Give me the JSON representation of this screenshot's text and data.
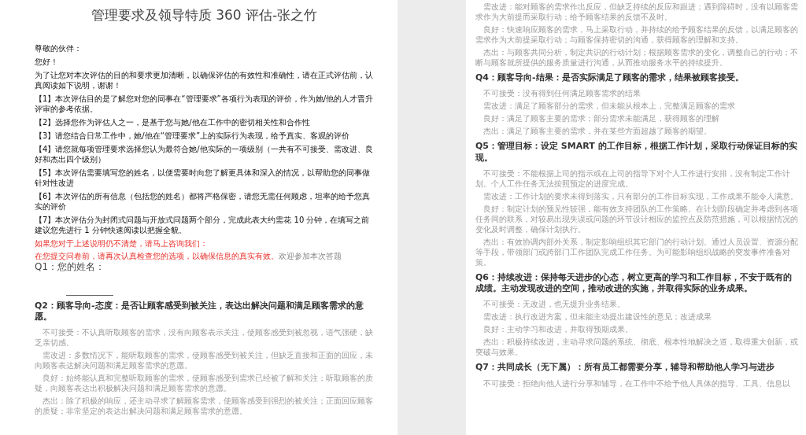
{
  "pages": [
    {
      "title": "管理要求及领导特质 360 评估-张之竹",
      "blocks": [
        {
          "kind": "text",
          "text": "尊敬的伙伴："
        },
        {
          "kind": "text",
          "text": "您好！"
        },
        {
          "kind": "text",
          "text": "为了让您对本次评估的目的和要求更加清晰，以确保评估的有效性和准确性，请在正式评估前，认真阅读如下说明，谢谢！"
        },
        {
          "kind": "text",
          "text": "【1】本次评估目的是了解您对您的同事在“管理要求”各项行为表现的评价，作为她/他的人才晋升评审的参考依据。"
        },
        {
          "kind": "text",
          "text": "【2】选择您作为评估人之一，是基于您与她/他在工作中的密切相关性和合作性"
        },
        {
          "kind": "text",
          "text": "【3】请您结合日常工作中，她/他在“管理要求”上的实际行为表现，给予真实、客观的评价"
        },
        {
          "kind": "text",
          "text": "【4】请您就每项管理要求选择您认为最符合她/他实际的一项级别（一共有不可接受、需改进、良好和杰出四个级别）"
        },
        {
          "kind": "text",
          "text": "【5】本次评估需要填写您的姓名，以便需要时向您了解更具体和深入的情况，以帮助您的同事做针对性改进"
        },
        {
          "kind": "text",
          "text": "【6】本次评估的所有信息（包括您的姓名）都将严格保密，请您无需任何顾虑，坦率的给予您真实的评价"
        },
        {
          "kind": "text",
          "text": "【7】本次评估分为封闭式问题与开放式问题两个部分，完成此表大约需花 10 分钟，在填写之前建议您先进行 1 分钟快速阅读以把握全貌。"
        },
        {
          "kind": "notice",
          "text": "如果您对于上述说明仍不清楚，请马上咨询我们："
        },
        {
          "kind": "notice",
          "text": "在您提交问卷前，请再次认真检查您的选项，以确保信息的真实有效。",
          "tail": "欢迎参加本次答题"
        },
        {
          "kind": "prompt",
          "text": "Q1：您的姓名："
        },
        {
          "kind": "blank"
        },
        {
          "kind": "question",
          "text": "Q2：顾客导向-态度：是否让顾客感受到被关注，表达出解决问题和满足顾客需求的意愿。"
        },
        {
          "kind": "level",
          "text": "不可接受：不认真听取顾客的需求，没有向顾客表示关注，使顾客感受到被忽视，语气强硬，缺乏亲切感。"
        },
        {
          "kind": "level",
          "text": "需改进：多数情况下，能听取顾客的需求，使顾客感受到被关注，但缺乏直接和正面的回应，未向顾客表达解决问题和满足顾客需求的意愿。"
        },
        {
          "kind": "level",
          "text": "良好：始终能认真和完整听取顾客的需求，使顾客感受到需求已经被了解和关注；听取顾客的质疑，向顾客表达出积极解决问题和满足顾客需求的意愿。"
        },
        {
          "kind": "level",
          "text": "杰出：除了积极的响应，还主动寻求了解顾客需求，使顾客感受到强烈的被关注；正面回应顾客的质疑；非常坚定的表达出解决问题和满足顾客需求的意愿。"
        }
      ]
    },
    {
      "blocks": [
        {
          "kind": "level",
          "text": "需改进：能对顾客的需求作出反应，但缺乏持续的反应和跟进；遇到障碍时，没有以顾客需求作为大前提而采取行动；给予顾客结果的反馈不及时。"
        },
        {
          "kind": "level",
          "text": "良好：快速响应顾客的需求，马上采取行动，并持续的给予顾客结果的反馈，以满足顾客的需求作为大前提采取行动；与顾客保持密切的沟通，获得顾客的理解和支持。"
        },
        {
          "kind": "level",
          "text": "杰出：与顾客共同分析，制定共识的行动计划；根据顾客需求的变化，调整自己的行动；不断与顾客就所提供的服务质量进行沟通，从而推动服务水平的持续提升。"
        },
        {
          "kind": "question",
          "text": "Q4：顾客导向-结果：是否实际满足了顾客的需求，结果被顾客接受。"
        },
        {
          "kind": "level",
          "text": "不可接受：没有得到任何满足顾客需求的结果"
        },
        {
          "kind": "level",
          "text": "需改进：满足了顾客部分的需求，但未能从根本上，完整满足顾客的需求"
        },
        {
          "kind": "level",
          "text": "良好：满足了顾客主要的需求；部分需求未能满足，获得顾客的理解"
        },
        {
          "kind": "level",
          "text": "杰出：满足了顾客主要的需求，并在某些方面超越了顾客的期望。"
        },
        {
          "kind": "question",
          "text": "Q5：管理目标：设定 SMART 的工作目标，根据工作计划，采取行动保证目标的实现。"
        },
        {
          "kind": "level",
          "text": "不可接受：不能根据上司的指示或在上司的指导下对个人工作进行安排，没有制定工作计划。个人工作任务无法按照预定的进度完成。"
        },
        {
          "kind": "level",
          "text": "需改进：工作计划的要求未得到落实，只有部分的工作目标实现，工作成果不能令人满意。"
        },
        {
          "kind": "level",
          "text": "良好：制定计划的预见性较强，能有效支持团队的工作策略。在计划阶段确定并考虑到各项任务间的联系，对较易出现失误或问题的环节设计相应的监控点及防范措施，可以根据情况的变化及时调整，确保计划执行。"
        },
        {
          "kind": "level",
          "text": "杰出：有效协调内部外关系，制定影响组织其它部门的行动计划。通过人员设置、资源分配等手段，带领部门或跨部门工作团队完成工作任务。为可能影响组织战略的突发事件准备对策。"
        },
        {
          "kind": "question",
          "text": "Q6：持续改进：保持每天进步的心态，树立更高的学习和工作目标，不安于既有的成绩。主动发现改进的空间，推动改进的实施，并取得实际的业务成果。"
        },
        {
          "kind": "level",
          "text": "不可接受：无改进，也无提升业务结果。"
        },
        {
          "kind": "level",
          "text": "需改进：执行改进方案，但未能主动提出建设性的意见；改进成果"
        },
        {
          "kind": "level",
          "text": "良好：主动学习和改进，并取得预期成果。"
        },
        {
          "kind": "level",
          "text": "杰出：积极持续改进，主动寻求问题的系统、彻底、根本性地解决之道，取得重大创新，或突破与效果。"
        },
        {
          "kind": "question",
          "text": "Q7：共同成长（无下属）：所有员工都需要分享，辅导和帮助他人学习与进步"
        },
        {
          "kind": "level",
          "text": "不可接受：拒绝向他人进行分享和辅导，在工作中不给予他人具体的指导、工具、信息以"
        }
      ]
    }
  ]
}
